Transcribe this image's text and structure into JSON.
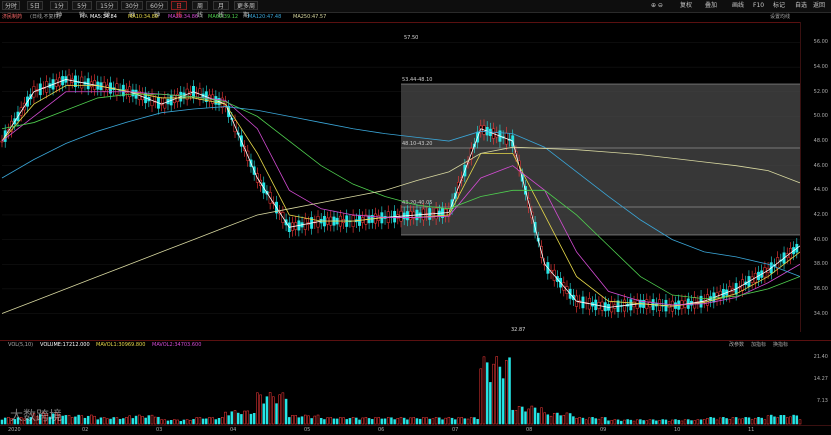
{
  "toolbar": {
    "left_buttons": [
      "分时",
      "5日",
      "1分钟",
      "5分钟",
      "15分钟",
      "30分钟",
      "60分钟",
      "日线",
      "周线",
      "月线",
      "更多周期"
    ],
    "active_button": "日线",
    "right_items": [
      "复权",
      "叠加",
      "画线",
      "F10",
      "标记",
      "自选",
      "返回"
    ]
  },
  "ma_bar": {
    "name": "济民制药",
    "subtitle": "(日线,不复权)",
    "ma_label": "MA",
    "ma5": "MA5:34.84",
    "ma10": "MA10:34.89",
    "ma20": "MA20:34.86",
    "ma60": "MA60:39.12",
    "ma120": "MA120:47.48",
    "ma250": "MA250:47.57",
    "settings": "设置均线"
  },
  "annotations": {
    "high": "57.50",
    "low": "32.87",
    "levels": [
      "53.44-48.10",
      "48.10-43.20",
      "43.20-40.05"
    ]
  },
  "volume_bar": {
    "label": "VOL(5,10)",
    "volume": "VOLUME:17212.000",
    "mavol1": "MAVOL1:30969.800",
    "mavol2": "MAVOL2:34703.600",
    "tools": [
      "改参数",
      "加指标",
      "换指标"
    ]
  },
  "watermark": "大数跨境",
  "colors": {
    "up": "#ff3b3b",
    "down": "#26e6e6",
    "ma5": "#ffffff",
    "ma10": "#e6d84a",
    "ma20": "#d24bd2",
    "ma60": "#4fcf4f",
    "ma120": "#3aa6d8",
    "ma250": "#d8d8a0"
  },
  "chart_data": {
    "type": "line",
    "title": "济民制药",
    "y_ticks": [
      56.0,
      54.0,
      52.0,
      50.0,
      48.0,
      46.0,
      44.0,
      42.0,
      40.0,
      38.0,
      36.0,
      34.0
    ],
    "vol_ticks": [
      "21.40",
      "14.27",
      "7.13"
    ],
    "x_ticks": [
      "2020",
      "02",
      "03",
      "04",
      "05",
      "06",
      "07",
      "08",
      "09",
      "10",
      "11"
    ],
    "ylim": [
      32.5,
      57.5
    ],
    "x": [
      0,
      10,
      20,
      30,
      40,
      50,
      60,
      70,
      80,
      90,
      100,
      110,
      120,
      130,
      140,
      150,
      160,
      170,
      180,
      190,
      200,
      210,
      220,
      230,
      240,
      250
    ],
    "series": [
      {
        "name": "MA5",
        "values": [
          48,
          52,
          53,
          52.5,
          52,
          51,
          52,
          51,
          45,
          41,
          41.5,
          41.5,
          41.8,
          42,
          42.2,
          49,
          48,
          38,
          35,
          34.5,
          34.8,
          34.6,
          35,
          36,
          37.5,
          39.5
        ]
      },
      {
        "name": "MA10",
        "values": [
          48,
          51,
          52.5,
          52.5,
          52,
          51.5,
          51.5,
          51,
          47,
          42,
          41.5,
          41.5,
          41.8,
          41.8,
          42,
          47,
          47,
          42,
          37,
          35,
          34.8,
          34.6,
          34.9,
          35.6,
          37,
          39
        ]
      },
      {
        "name": "MA20",
        "values": [
          48,
          50,
          52,
          52,
          52,
          51.8,
          51.6,
          51.3,
          49,
          44,
          42.5,
          42,
          41.8,
          41.8,
          41.9,
          45,
          46,
          44,
          39,
          35.8,
          35,
          34.7,
          34.8,
          35.3,
          36.5,
          38
        ]
      },
      {
        "name": "MA60",
        "values": [
          49,
          49.5,
          50.5,
          51.5,
          51.8,
          51.8,
          51.6,
          51.2,
          50,
          48,
          46,
          44.5,
          43.5,
          42.8,
          42.5,
          43.5,
          44,
          44,
          42,
          39.5,
          37,
          35.5,
          35.2,
          35.4,
          36,
          37
        ]
      },
      {
        "name": "MA120",
        "values": [
          45,
          46.5,
          47.8,
          48.8,
          49.6,
          50.3,
          50.6,
          50.8,
          50.5,
          50,
          49.5,
          49,
          48.6,
          48.3,
          48,
          48.8,
          48.6,
          47.5,
          45.5,
          43.5,
          41.6,
          40,
          39,
          38.6,
          38,
          37
        ]
      },
      {
        "name": "MA250",
        "values": [
          34,
          35,
          36,
          37,
          38,
          39,
          40,
          41,
          42,
          42.5,
          43,
          43.5,
          44,
          44.8,
          45.5,
          47,
          47.5,
          47.4,
          47.3,
          47.1,
          46.9,
          46.6,
          46.3,
          46,
          45.6,
          44.6
        ]
      }
    ],
    "volumes": [
      3,
      5,
      4,
      3,
      4,
      2,
      3,
      6,
      14,
      4,
      3,
      3,
      3,
      3,
      3,
      30,
      8,
      5,
      3,
      2,
      2,
      2,
      3,
      3,
      4,
      3
    ]
  }
}
